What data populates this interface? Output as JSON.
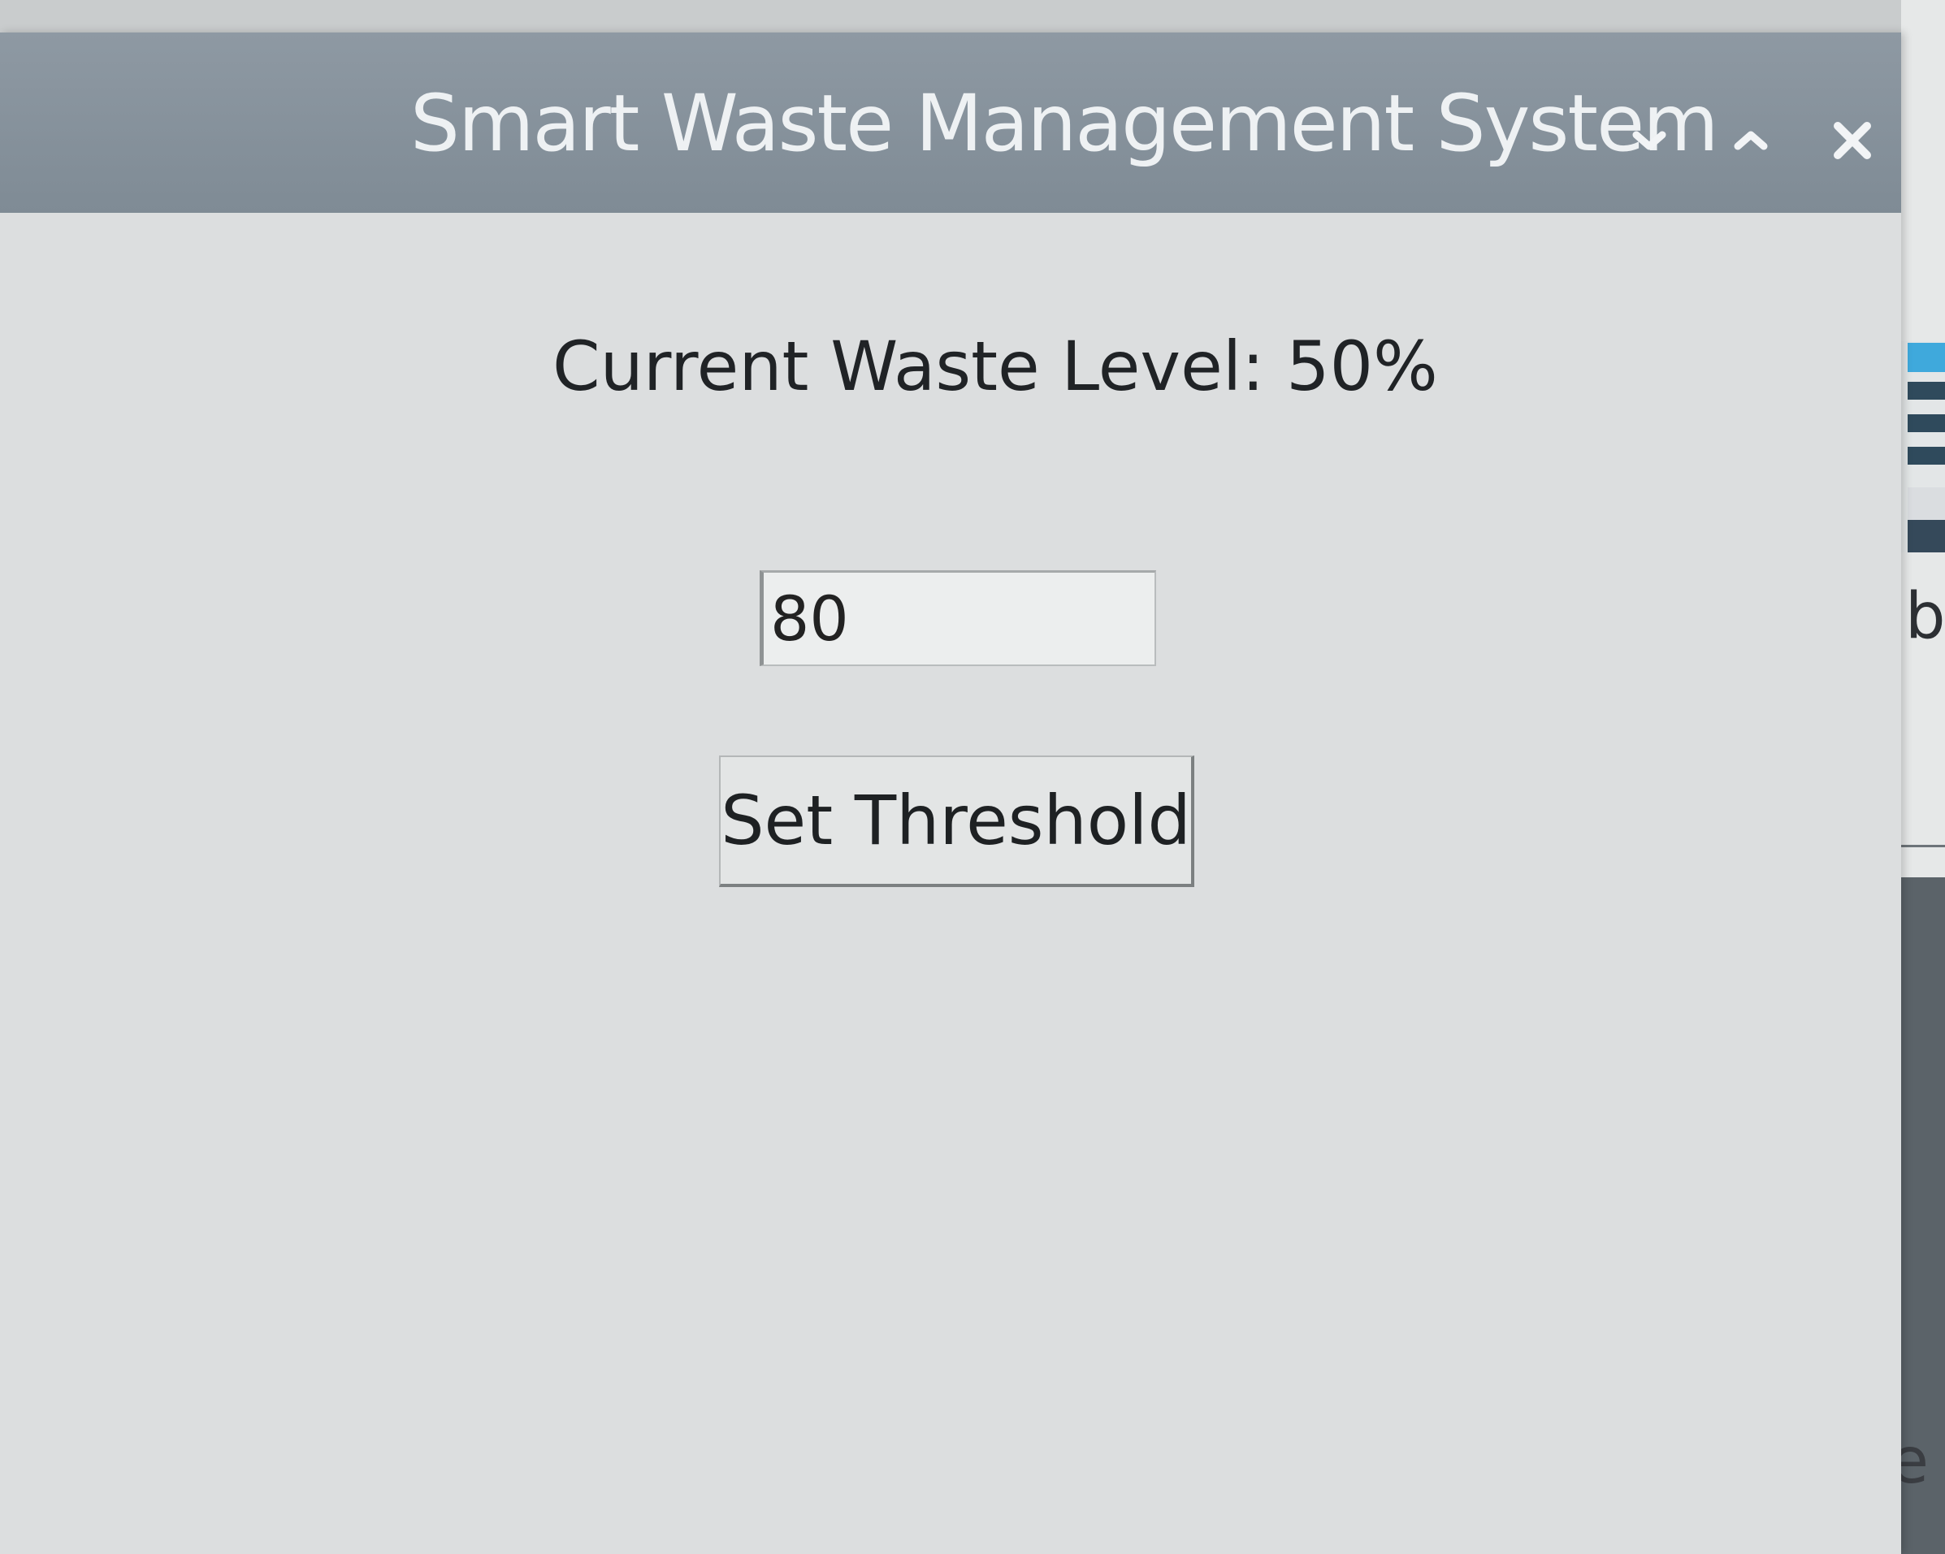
{
  "window": {
    "title": "Smart Waste Management System"
  },
  "title_bar_controls": {
    "minimize_icon": "chevron-down-icon",
    "maximize_icon": "chevron-up-icon",
    "close_icon": "close-icon"
  },
  "main": {
    "waste_level_text": "Current Waste Level: 50%",
    "threshold_input_value": "80",
    "set_threshold_label": "Set Threshold"
  },
  "background": {
    "glyph_b": "b",
    "glyph_e": "e"
  },
  "colors": {
    "title_bar": "#8a96a0",
    "title_text": "#eef1f3",
    "content_bg": "#dcdedf",
    "background_accent": "#3fa9dc"
  }
}
